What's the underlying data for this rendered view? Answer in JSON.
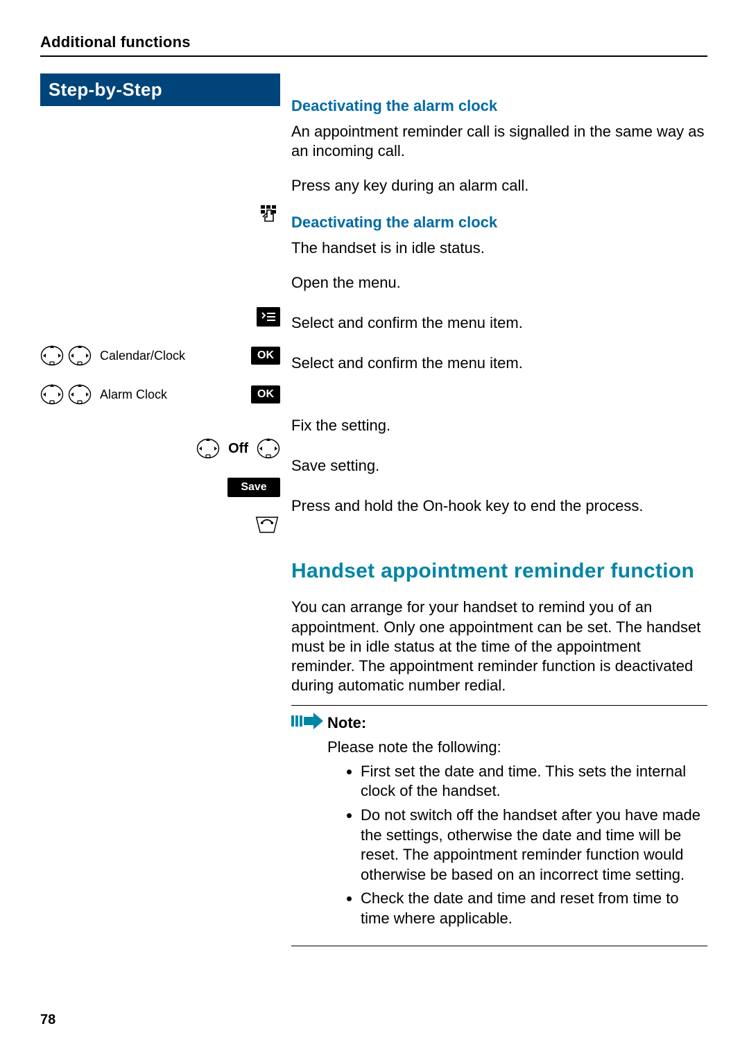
{
  "header": {
    "section": "Additional functions",
    "step_banner": "Step-by-Step"
  },
  "alarm": {
    "sub1": "Deactivating the alarm clock",
    "p1": "An appointment reminder call is signalled in the same way as an incoming call.",
    "p2": "Press any key during an alarm call.",
    "sub2": "Deactivating the alarm clock",
    "p3": "The handset is in idle status.",
    "open_menu": "Open the menu.",
    "select_confirm": "Select and confirm the menu item.",
    "fix": "Fix the setting.",
    "save": "Save setting.",
    "end": "Press and hold the On-hook key to end the process."
  },
  "left": {
    "calendar": "Calendar/Clock",
    "alarmclock": "Alarm Clock",
    "off_label": "Off",
    "ok": "OK",
    "save": "Save"
  },
  "section2": {
    "title": "Handset appointment reminder function",
    "intro": "You can arrange for your handset to remind you of an appointment. Only one appointment can be set. The handset must be in idle status at the time of the appointment reminder. The appointment reminder function is deactivated during automatic number redial.",
    "note_label": "Note:",
    "note_intro": "Please note the following:",
    "bullets": [
      "First set the date and time. This sets the internal clock of the handset.",
      "Do not switch off the handset after you have made the settings, otherwise the date and time will be reset. The appointment reminder function would otherwise be based on an incorrect time setting.",
      "Check the date and time and reset from time to time where applicable."
    ]
  },
  "page_number": "78"
}
